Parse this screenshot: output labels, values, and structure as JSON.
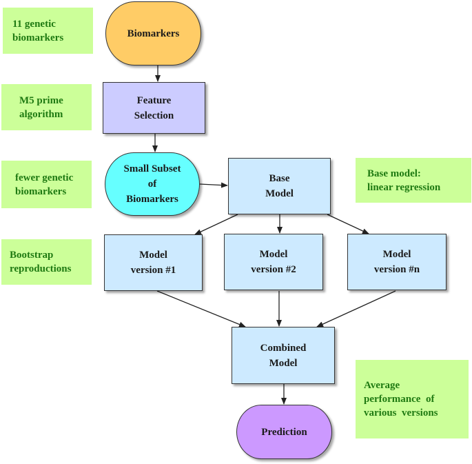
{
  "diagram": {
    "nodes": {
      "biomarkers": {
        "lines": [
          "Biomarkers"
        ],
        "color": "#ffcc66"
      },
      "feature_selection": {
        "lines": [
          "Feature",
          "Selection"
        ],
        "color": "#ccccff"
      },
      "small_subset": {
        "lines": [
          "Small Subset",
          "of",
          "Biomarkers"
        ],
        "color": "#66ffff"
      },
      "base_model": {
        "lines": [
          "Base",
          "Model"
        ],
        "color": "#cdeaff"
      },
      "model_v1": {
        "lines": [
          "Model",
          "version #1"
        ],
        "color": "#cdeaff"
      },
      "model_v2": {
        "lines": [
          "Model",
          "version #2"
        ],
        "color": "#cdeaff"
      },
      "model_vn": {
        "lines": [
          "Model",
          "version #n"
        ],
        "color": "#cdeaff"
      },
      "combined_model": {
        "lines": [
          "Combined",
          "Model"
        ],
        "color": "#cdeaff"
      },
      "prediction": {
        "lines": [
          "Prediction"
        ],
        "color": "#cc99ff"
      }
    },
    "notes": {
      "genetic": {
        "lines": [
          "11 genetic",
          "biomarkers"
        ]
      },
      "m5": {
        "lines": [
          "M5 prime",
          "algorithm"
        ]
      },
      "fewer": {
        "lines": [
          "fewer genetic",
          "biomarkers"
        ]
      },
      "bootstrap": {
        "lines": [
          "Bootstrap",
          "reproductions"
        ]
      },
      "base_model_note": {
        "lines": [
          "Base model:",
          "linear regression"
        ]
      },
      "average": {
        "lines": [
          "Average",
          "performance  of",
          "various  versions"
        ]
      }
    },
    "edges": [
      [
        "biomarkers",
        "feature_selection"
      ],
      [
        "feature_selection",
        "small_subset"
      ],
      [
        "small_subset",
        "base_model"
      ],
      [
        "base_model",
        "model_v1"
      ],
      [
        "base_model",
        "model_v2"
      ],
      [
        "base_model",
        "model_vn"
      ],
      [
        "model_v1",
        "combined_model"
      ],
      [
        "model_v2",
        "combined_model"
      ],
      [
        "model_vn",
        "combined_model"
      ],
      [
        "combined_model",
        "prediction"
      ]
    ],
    "colors": {
      "note_bg": "#ccff99",
      "note_text": "#1f7a12",
      "edge": "#222222"
    }
  }
}
